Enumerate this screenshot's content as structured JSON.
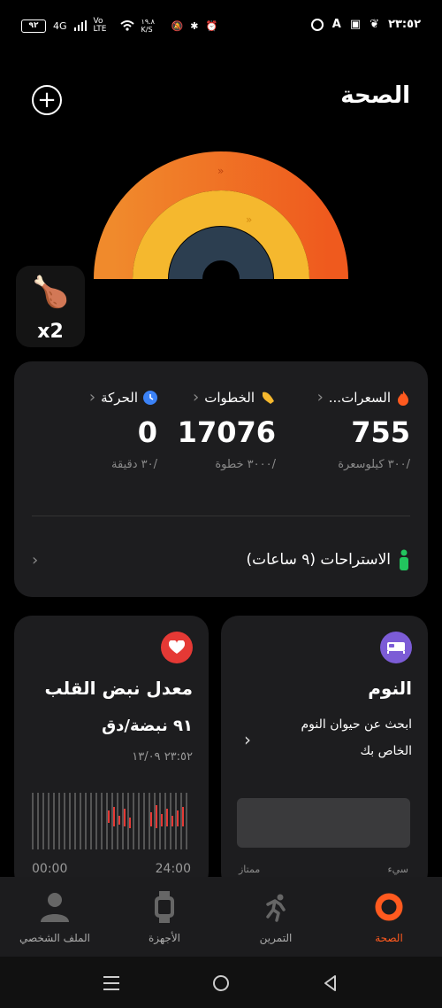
{
  "status_bar": {
    "battery": "٩٢",
    "network": "4G",
    "volte": "Vo LTE",
    "speed": "١٩.٨ K/S",
    "time": "٢٣:٥٢"
  },
  "header": {
    "title": "الصحة"
  },
  "reward": {
    "multiplier": "x2"
  },
  "activity": {
    "calories": {
      "label": "السعرات...",
      "value": "755",
      "goal": "/٣٠٠ كيلوسعرة"
    },
    "steps": {
      "label": "الخطوات",
      "value": "17076",
      "goal": "/٣٠٠٠ خطوة"
    },
    "move": {
      "label": "الحركة",
      "value": "0",
      "goal": "/٣٠ دقيقة"
    },
    "rest": {
      "label": "الاستراحات (٩ ساعات)"
    }
  },
  "sleep": {
    "title": "النوم",
    "description": "ابحث عن حيوان النوم الخاص بك",
    "axis_left": "ممتاز",
    "axis_right": "سيء"
  },
  "heart": {
    "title": "معدل نبض القلب",
    "value": "٩١ نبضة/دق",
    "time": "٢٣:٥٢ ١٣/٠٩",
    "axis_start": "00:00",
    "axis_end": "24:00"
  },
  "nav": {
    "health": "الصحة",
    "workout": "التمرين",
    "devices": "الأجهزة",
    "profile": "الملف الشخصي"
  },
  "colors": {
    "accent": "#ff5a1f",
    "ring_outer": "#f26b21",
    "ring_middle": "#f5b82e",
    "ring_inner": "#2c3e50",
    "sleep_icon": "#7c5cd6",
    "heart_icon": "#e53935"
  }
}
